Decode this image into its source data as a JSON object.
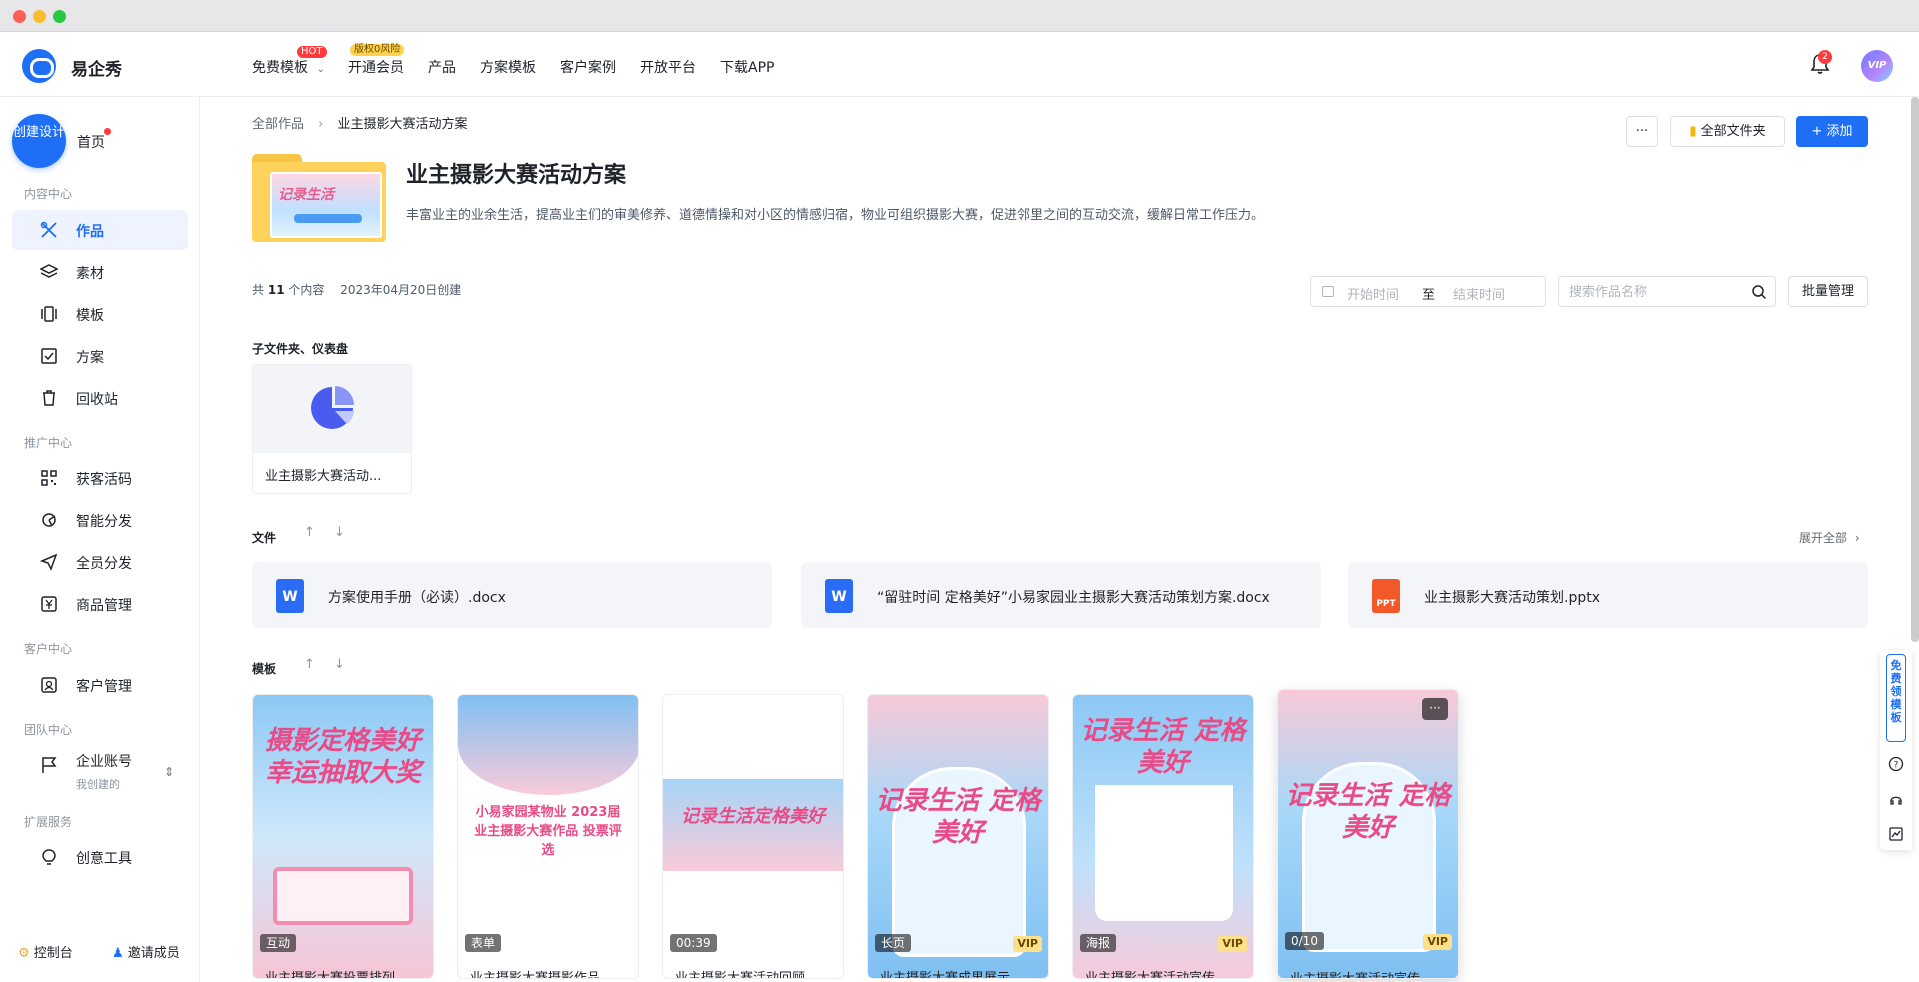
{
  "app": {
    "name": "易企秀"
  },
  "topnav": {
    "items": [
      {
        "label": "免费模板",
        "badge": "HOT"
      },
      {
        "label": "开通会员",
        "badge": "版权0风险"
      },
      {
        "label": "产品"
      },
      {
        "label": "方案模板"
      },
      {
        "label": "客户案例"
      },
      {
        "label": "开放平台"
      },
      {
        "label": "下载APP"
      }
    ],
    "notifications": "2",
    "avatar_label": "VIP"
  },
  "sidebar": {
    "create_label": "创建设计",
    "home": "首页",
    "sections": [
      {
        "title": "内容中心",
        "items": [
          "作品",
          "素材",
          "模板",
          "方案",
          "回收站"
        ]
      },
      {
        "title": "推广中心",
        "items": [
          "获客活码",
          "智能分发",
          "全员分发",
          "商品管理"
        ]
      },
      {
        "title": "客户中心",
        "items": [
          "客户管理"
        ]
      },
      {
        "title": "团队中心",
        "items": [
          "企业账号"
        ],
        "sub": "我创建的"
      },
      {
        "title": "扩展服务",
        "items": [
          "创意工具"
        ]
      }
    ],
    "bottom": {
      "console": "控制台",
      "invite": "邀请成员"
    }
  },
  "main": {
    "breadcrumb": [
      "全部作品",
      "业主摄影大赛活动方案"
    ],
    "buttons": {
      "more": "···",
      "all_folders": "全部文件夹",
      "add": "+ 添加"
    },
    "folder_thumb": "记录生活",
    "title": "业主摄影大赛活动方案",
    "description": "丰富业主的业余生活，提高业主们的审美修养、道德情操和对小区的情感归宿，物业可组织摄影大赛，促进邻里之间的互动交流，缓解日常工作压力。",
    "meta": {
      "prefix": "共",
      "count": "11",
      "suffix": "个内容",
      "created": "2023年04月20日创建"
    },
    "filter": {
      "start_placeholder": "开始时间",
      "to": "至",
      "end_placeholder": "结束时间"
    },
    "search": {
      "placeholder": "搜索作品名称"
    },
    "batch": "批量管理",
    "subfolder_section": "子文件夹、仪表盘",
    "dashboard_card": "业主摄影大赛活动...",
    "files_section": "文件",
    "expand_all": "展开全部",
    "files": [
      {
        "name": "方案使用手册（必读）.docx",
        "type": "W"
      },
      {
        "name": "“留驻时间 定格美好”小易家园业主摄影大赛活动策划方案.docx",
        "type": "W"
      },
      {
        "name": "业主摄影大赛活动策划.pptx",
        "type": "PPT"
      }
    ],
    "templates_section": "模板",
    "templates": [
      {
        "tag": "互动",
        "vip": "",
        "name": "业主摄影大赛投票排列",
        "headline": "摄影定格美好 幸运抽取大奖"
      },
      {
        "tag": "表单",
        "vip": "",
        "name": "业主摄影大赛摄影作品",
        "headline": "小易家园某物业 2023届业主摄影大赛作品 投票评选"
      },
      {
        "tag": "00:39",
        "vip": "",
        "name": "业主摄影大赛活动回顾",
        "headline": "记录生活定格美好"
      },
      {
        "tag": "长页",
        "vip": "VIP",
        "name": "业主摄影大赛成果展示",
        "headline": "记录生活 定格美好"
      },
      {
        "tag": "海报",
        "vip": "VIP",
        "name": "业主摄影大赛活动宣传",
        "headline": "记录生活 定格美好"
      },
      {
        "tag": "0/10",
        "vip": "VIP",
        "name": "业主摄影大赛活动宣传",
        "headline": "记录生活 定格美好"
      }
    ]
  },
  "float_panel": {
    "free_templates": "免费领模板"
  },
  "colors": {
    "accent": "#1e6ff5",
    "folder": "#ffd25c",
    "danger": "#ff3b3b"
  }
}
